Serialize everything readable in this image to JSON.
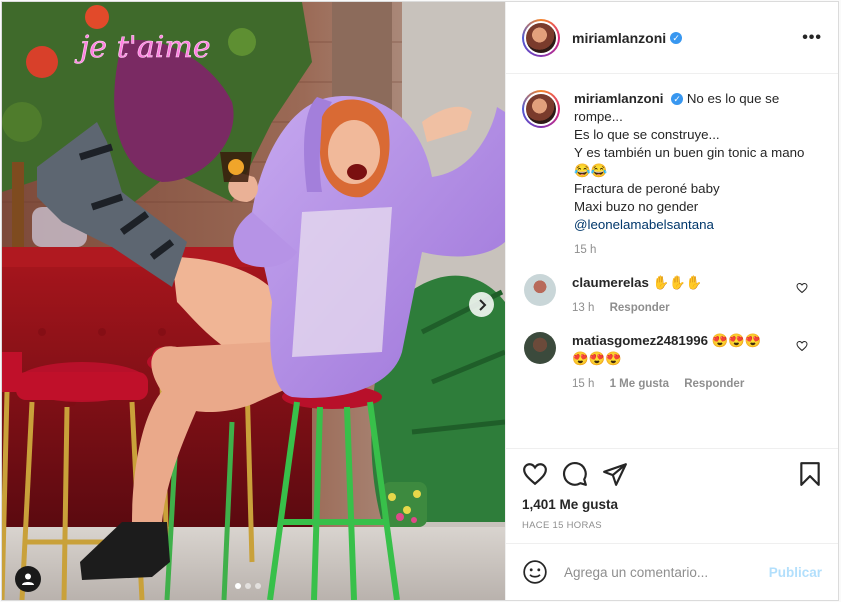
{
  "post": {
    "username": "miriamlanzoni",
    "media": {
      "neon_sign": "je t'aime",
      "active_slide": 1,
      "slide_count": 3
    },
    "caption": {
      "username": "miriamlanzoni",
      "lines": [
        "No es lo que se rompe...",
        "Es lo que se construye...",
        "Y es también un buen gin tonic a mano 😂😂",
        "Fractura de peroné baby",
        "Maxi buzo no gender"
      ],
      "mention": "@leonelamabelsantana",
      "time": "15 h"
    },
    "comments": [
      {
        "username": "claumerelas",
        "text": "✋✋✋",
        "time": "13 h",
        "reply": "Responder"
      },
      {
        "username": "matiasgomez2481996",
        "text": "😍😍😍😍😍😍",
        "time": "15 h",
        "likes": "1 Me gusta",
        "reply": "Responder"
      }
    ],
    "likes": "1,401 Me gusta",
    "timestamp": "HACE 15 HORAS",
    "add_comment": {
      "placeholder": "Agrega un comentario...",
      "publish": "Publicar"
    }
  },
  "colors": {
    "verified": "#3897f0",
    "publish_disabled": "#b2dffc",
    "mention": "#00376b"
  },
  "icons": [
    "verified-icon",
    "more-options-icon",
    "heart-icon",
    "comment-icon",
    "share-icon",
    "bookmark-icon",
    "emoji-icon",
    "chevron-right-icon",
    "user-tag-icon"
  ]
}
